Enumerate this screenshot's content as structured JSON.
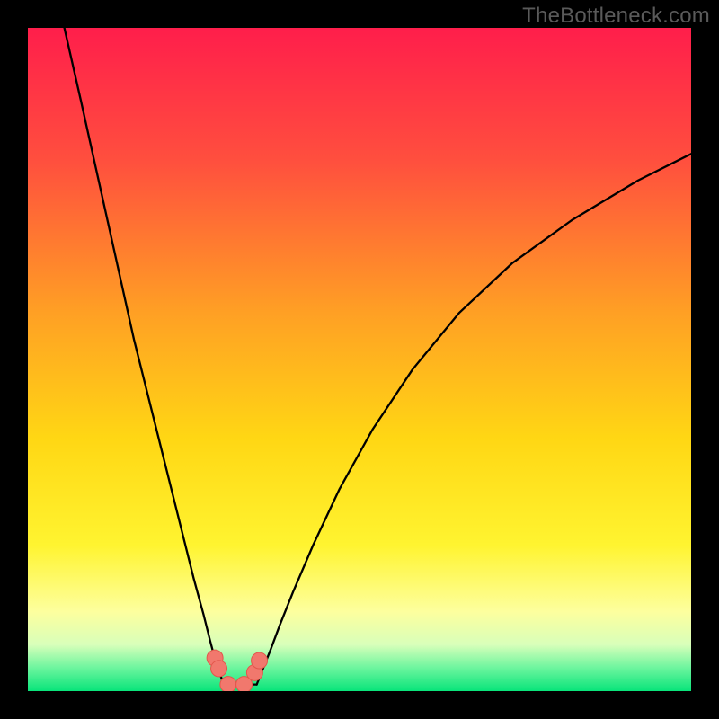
{
  "watermark": "TheBottleneck.com",
  "chart_data": {
    "type": "line",
    "title": "",
    "xlabel": "",
    "ylabel": "",
    "xlim": [
      0,
      100
    ],
    "ylim": [
      0,
      100
    ],
    "grid": false,
    "background_gradient": {
      "stops": [
        {
          "offset": 0.0,
          "color": "#ff1e4b"
        },
        {
          "offset": 0.2,
          "color": "#ff4f3e"
        },
        {
          "offset": 0.43,
          "color": "#ffa024"
        },
        {
          "offset": 0.62,
          "color": "#ffd714"
        },
        {
          "offset": 0.78,
          "color": "#fff430"
        },
        {
          "offset": 0.88,
          "color": "#fdff9e"
        },
        {
          "offset": 0.93,
          "color": "#d8ffba"
        },
        {
          "offset": 0.965,
          "color": "#6cf59e"
        },
        {
          "offset": 1.0,
          "color": "#08e47a"
        }
      ]
    },
    "series": [
      {
        "name": "left-curve",
        "x": [
          5.5,
          8,
          10,
          12,
          14,
          16,
          18,
          20,
          22,
          23.5,
          25,
          26.5,
          27.5,
          28.3,
          29,
          29.5
        ],
        "y": [
          100,
          89,
          80,
          71,
          62,
          53,
          45,
          37,
          29,
          23,
          17,
          11.5,
          7.5,
          4.5,
          2.5,
          1
        ]
      },
      {
        "name": "right-curve",
        "x": [
          34.5,
          35.3,
          36.5,
          38,
          40,
          43,
          47,
          52,
          58,
          65,
          73,
          82,
          92,
          100
        ],
        "y": [
          1,
          3,
          6,
          10,
          15,
          22,
          30.5,
          39.5,
          48.5,
          57,
          64.5,
          71,
          77,
          81
        ]
      },
      {
        "name": "baseline-flat",
        "x": [
          29.5,
          34.5
        ],
        "y": [
          1,
          1
        ]
      }
    ],
    "markers": [
      {
        "name": "m1",
        "x": 28.2,
        "y": 5.0
      },
      {
        "name": "m2",
        "x": 28.8,
        "y": 3.4
      },
      {
        "name": "m3",
        "x": 30.2,
        "y": 1.0
      },
      {
        "name": "m4",
        "x": 32.6,
        "y": 1.0
      },
      {
        "name": "m5",
        "x": 34.2,
        "y": 2.8
      },
      {
        "name": "m6",
        "x": 34.9,
        "y": 4.6
      }
    ],
    "marker_style": {
      "radius": 9,
      "fill": "#f1786d",
      "stroke": "#e2564b"
    }
  }
}
